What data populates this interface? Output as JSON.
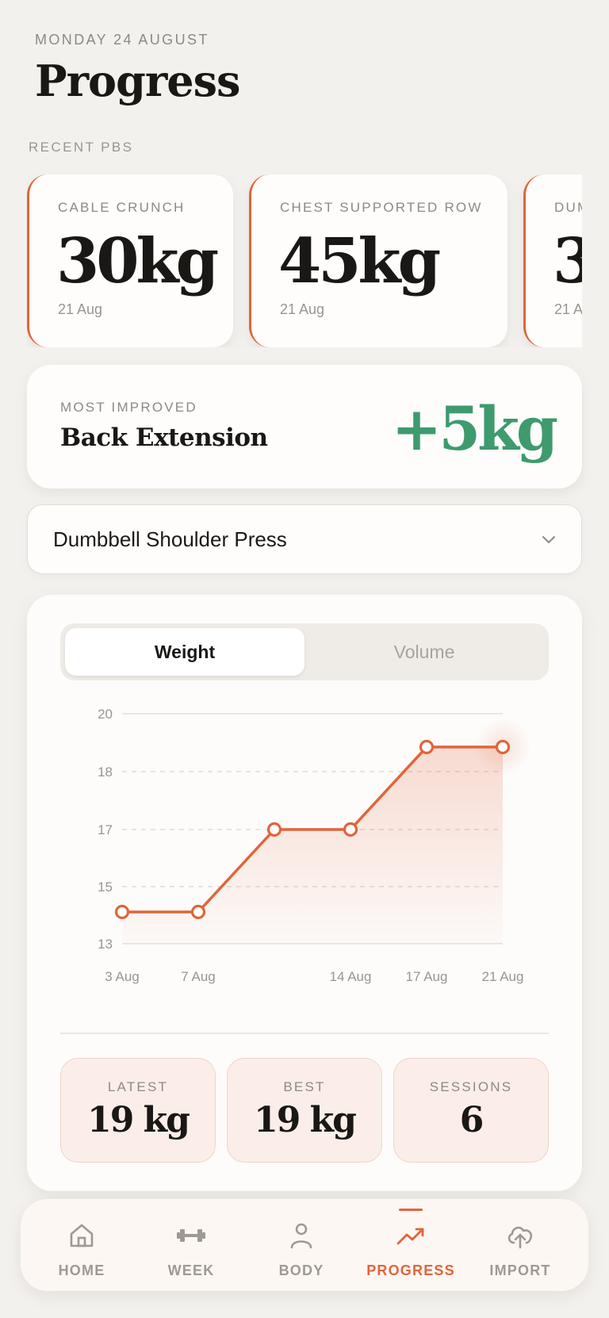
{
  "header": {
    "date": "MONDAY 24 AUGUST",
    "title": "Progress"
  },
  "recent_pbs": {
    "label": "RECENT PBS",
    "items": [
      {
        "name": "CABLE CRUNCH",
        "value": "30kg",
        "date": "21 Aug"
      },
      {
        "name": "CHEST SUPPORTED ROW",
        "value": "45kg",
        "date": "21 Aug"
      },
      {
        "name": "DUM",
        "value": "3",
        "date": "21 A"
      }
    ]
  },
  "most_improved": {
    "label": "MOST IMPROVED",
    "exercise": "Back Extension",
    "value": "+5kg"
  },
  "exercise_select": {
    "value": "Dumbbell Shoulder Press"
  },
  "toggle": {
    "weight_label": "Weight",
    "volume_label": "Volume"
  },
  "chart_data": {
    "type": "line",
    "title": "",
    "xlabel": "",
    "ylabel": "",
    "y_ticks": [
      "20",
      "18",
      "17",
      "15",
      "13"
    ],
    "x_tick_labels": [
      "3 Aug",
      "7 Aug",
      "14 Aug",
      "17 Aug",
      "21 Aug"
    ],
    "x": [
      "3 Aug",
      "7 Aug",
      "11 Aug",
      "14 Aug",
      "17 Aug",
      "21 Aug"
    ],
    "series": [
      {
        "values": [
          14,
          14,
          17,
          17,
          19,
          19
        ]
      }
    ],
    "ylim": [
      13,
      20
    ],
    "grid": true,
    "color": "#e0653a"
  },
  "stats": [
    {
      "label": "LATEST",
      "value": "19 kg"
    },
    {
      "label": "BEST",
      "value": "19 kg"
    },
    {
      "label": "SESSIONS",
      "value": "6"
    }
  ],
  "tabs": [
    {
      "label": "HOME",
      "icon": "home-icon"
    },
    {
      "label": "WEEK",
      "icon": "dumbbell-icon"
    },
    {
      "label": "BODY",
      "icon": "person-icon"
    },
    {
      "label": "PROGRESS",
      "icon": "trending-up-icon"
    },
    {
      "label": "IMPORT",
      "icon": "cloud-upload-icon"
    }
  ],
  "colors": {
    "accent": "#e0653a",
    "positive": "#3f9a6e",
    "background": "#f3f1ee"
  }
}
